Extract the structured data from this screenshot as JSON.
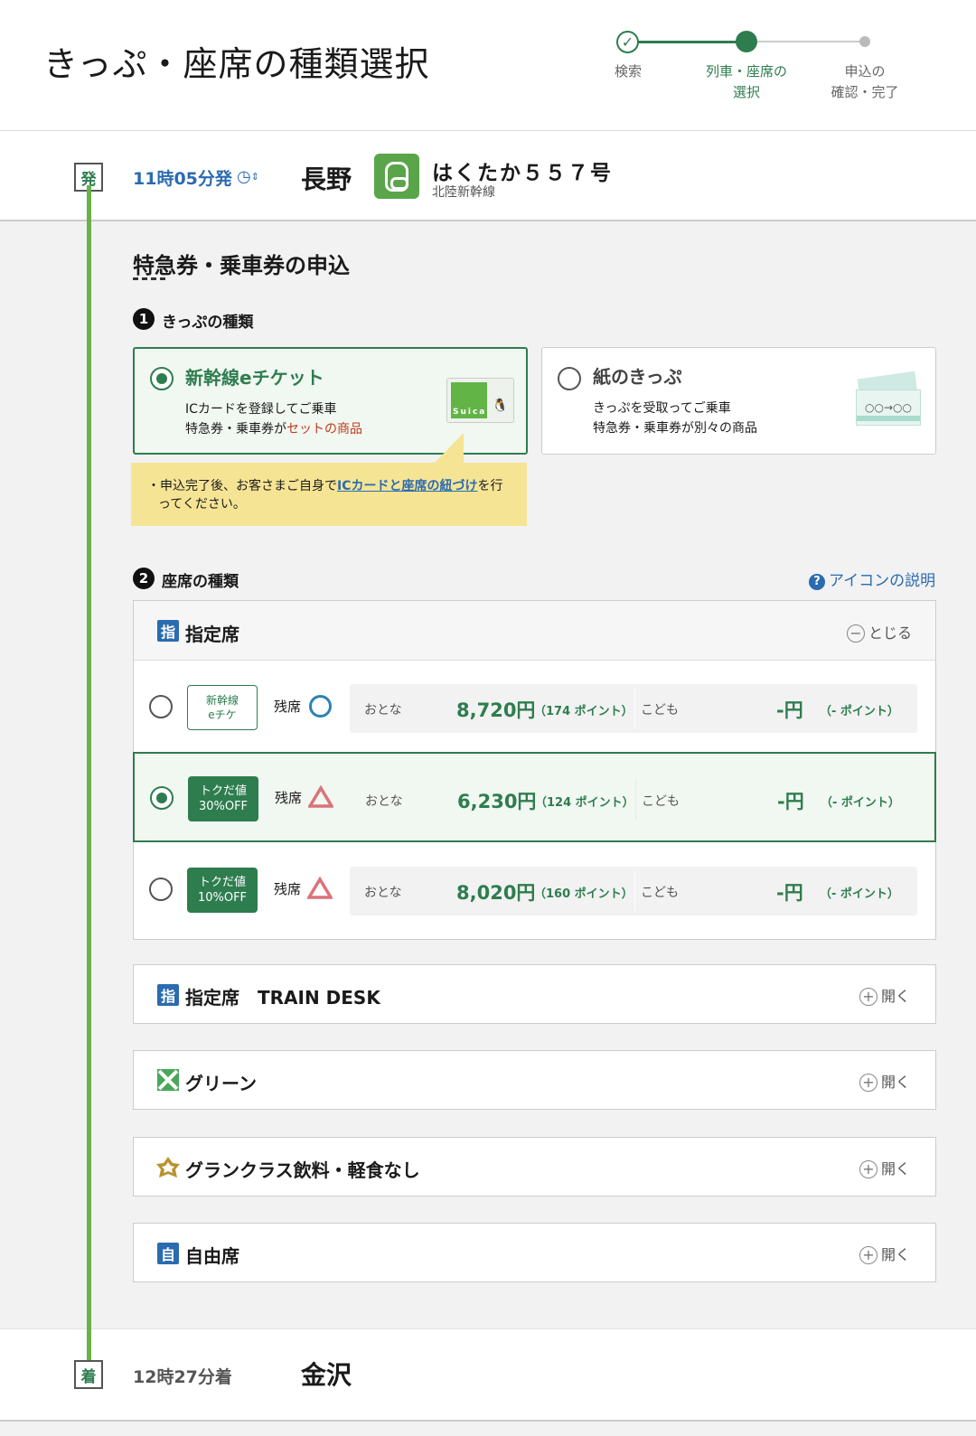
{
  "header": {
    "title": "きっぷ・座席の種類選択",
    "steps": [
      {
        "label_line1": "検索",
        "label_line2": ""
      },
      {
        "label_line1": "列車・座席の",
        "label_line2": "選択"
      },
      {
        "label_line1": "申込の",
        "label_line2": "確認・完了"
      }
    ]
  },
  "departure": {
    "tag": "発",
    "time": "11時05分発",
    "station": "長野",
    "train_name": "はくたか５５７号",
    "train_line": "北陸新幹線"
  },
  "arrival": {
    "tag": "着",
    "time": "12時27分着",
    "station": "金沢"
  },
  "main": {
    "title": "特急券・乗車券の申込",
    "section1": {
      "num": "1",
      "title": "きっぷの種類"
    },
    "ticket_types": [
      {
        "title": "新幹線eチケット",
        "desc_line1": "ICカードを登録してご乗車",
        "desc_line2_a": "特急券・乗車券が",
        "desc_line2_b": "セットの商品",
        "card_text": "Suica",
        "selected": true
      },
      {
        "title": "紙のきっぷ",
        "desc_line1": "きっぷを受取ってご乗車",
        "desc_line2_a": "特急券・乗車券が別々の商品",
        "desc_line2_b": "",
        "ticket_text": "○○→○○",
        "selected": false
      }
    ],
    "note": {
      "prefix": "・申込完了後、お客さまご自身で",
      "link": "ICカードと座席の紐づけ",
      "suffix_line1": "を行",
      "line2": "ってください。"
    },
    "section2": {
      "num": "2",
      "title": "座席の種類"
    },
    "icon_help": "アイコンの説明",
    "seat_panel": {
      "sign": "指",
      "title": "指定席",
      "toggle": "とじる",
      "rows": [
        {
          "badge_line1": "新幹線",
          "badge_line2": "eチケ",
          "badge_style": "outline",
          "zanseki": "残席",
          "availability": "circle",
          "adult_label": "おとな",
          "adult_price": "8,720円",
          "adult_points": "（174 ポイント）",
          "child_label": "こども",
          "child_price": "-円",
          "child_points": "（- ポイント）",
          "selected": false
        },
        {
          "badge_line1": "トクだ値",
          "badge_line2": "30%OFF",
          "badge_style": "fill",
          "zanseki": "残席",
          "availability": "triangle",
          "adult_label": "おとな",
          "adult_price": "6,230円",
          "adult_points": "（124 ポイント）",
          "child_label": "こども",
          "child_price": "-円",
          "child_points": "（- ポイント）",
          "selected": true
        },
        {
          "badge_line1": "トクだ値",
          "badge_line2": "10%OFF",
          "badge_style": "fill",
          "zanseki": "残席",
          "availability": "triangle",
          "adult_label": "おとな",
          "adult_price": "8,020円",
          "adult_points": "（160 ポイント）",
          "child_label": "こども",
          "child_price": "-円",
          "child_points": "（- ポイント）",
          "selected": false
        }
      ]
    },
    "other_panels": [
      {
        "sign": "指",
        "icon": "reserved-seat-icon",
        "title": "指定席　TRAIN DESK",
        "toggle": "開く"
      },
      {
        "sign": "",
        "icon": "green-car-icon",
        "title": "グリーン",
        "toggle": "開く"
      },
      {
        "sign": "",
        "icon": "gran-class-icon",
        "title": "グランクラス飲料・軽食なし",
        "toggle": "開く"
      },
      {
        "sign": "自",
        "icon": "non-reserved-seat-icon",
        "title": "自由席",
        "toggle": "開く"
      }
    ]
  },
  "colors": {
    "accent_green": "#2e7d4f",
    "link_blue": "#2b6bb0",
    "timeline_green": "#6ab04c",
    "note_yellow": "#f6e495",
    "triangle_red": "#d9747a"
  }
}
